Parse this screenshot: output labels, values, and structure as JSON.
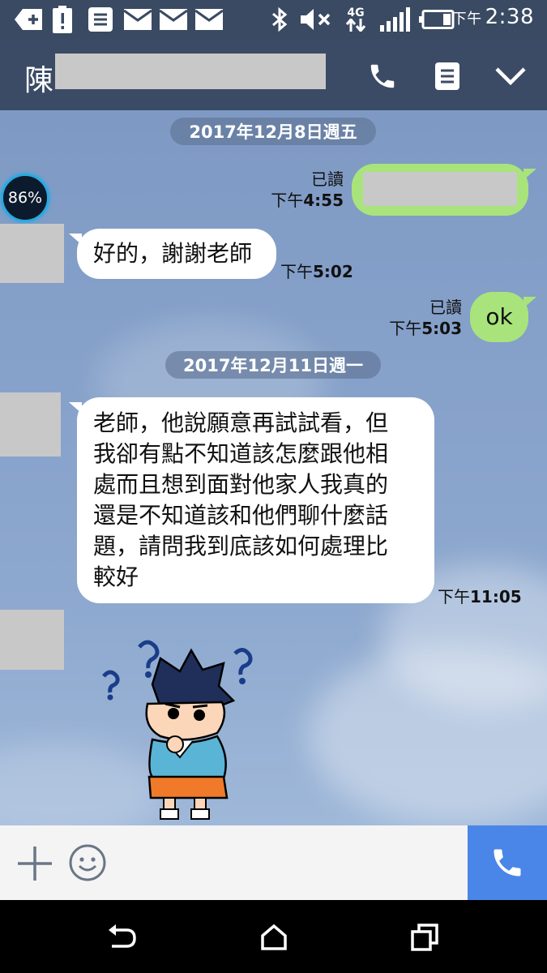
{
  "status_bar": {
    "time_prefix": "下午",
    "time": "2:38",
    "network": "4G"
  },
  "header": {
    "contact_name": "陳"
  },
  "chat": {
    "dates": [
      "2017年12月8日週五",
      "2017年12月11日週一"
    ],
    "badge_percent": "86%",
    "messages": [
      {
        "side": "out",
        "text": "",
        "read": "已讀",
        "time_prefix": "下午",
        "time": "4:55"
      },
      {
        "side": "in",
        "text": "好的，謝謝老師",
        "time_prefix": "下午",
        "time": "5:02"
      },
      {
        "side": "out",
        "text": "ok",
        "read": "已讀",
        "time_prefix": "下午",
        "time": "5:03"
      },
      {
        "side": "in",
        "lines": [
          "老師，他說願意再試試看，但",
          "我卻有點不知道該怎麼跟他相",
          "處而且想到面對他家人我真的",
          "還是不知道該和他們聊什麼話",
          "題，請問我到底該如何處理比",
          "較好"
        ],
        "time_prefix": "下午",
        "time": "11:05"
      },
      {
        "side": "in",
        "type": "sticker",
        "sticker": "confused-boy-sticker"
      }
    ]
  },
  "colors": {
    "header_bg": "#3b4b65",
    "outgoing_bubble": "#a8e47b",
    "call_button": "#4a86e8"
  }
}
